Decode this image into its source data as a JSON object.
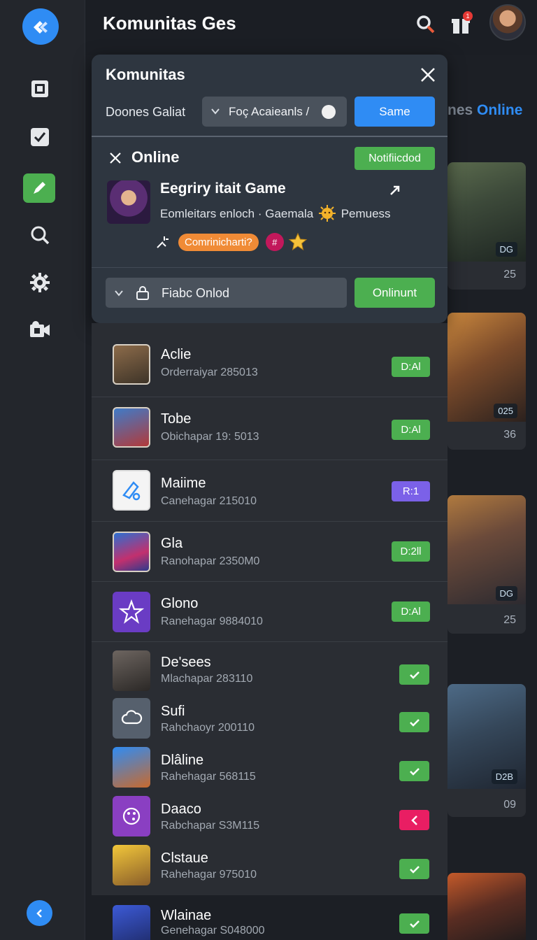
{
  "app": {
    "title": "Komunitas Ges"
  },
  "header": {
    "notification_count": "1"
  },
  "background": {
    "dim_text": "nes",
    "online_text": "Online",
    "cards": [
      {
        "tag": "DG",
        "number": "25"
      },
      {
        "tag": "025",
        "number": "36"
      },
      {
        "tag": "DG",
        "number": "25"
      },
      {
        "tag": "D2B",
        "number": "09"
      }
    ]
  },
  "modal": {
    "title": "Komunitas",
    "filter_label": "Doones Galiat",
    "filter_value": "Foç Acaieanls /",
    "save_label": "Same",
    "online_label": "Online",
    "notification_label": "Notifiicdod",
    "game": {
      "title": "Eegriry itait Game",
      "subtitle_a": "Eomleitars enloch · Gaemala",
      "subtitle_b": "Pemuess",
      "community_tag": "Comrinicharti?",
      "hash_chip": "#"
    },
    "online_select_value": "Fiabc Onlod",
    "online_button": "Onlinunt"
  },
  "list": [
    {
      "name": "Aclie",
      "meta": "Orderraiyar 285013",
      "badge": "D:Al",
      "badge_color": "green"
    },
    {
      "name": "Tobe",
      "meta": "Obichapar 19: 5013",
      "badge": "D:Al",
      "badge_color": "green"
    },
    {
      "name": "Maiime",
      "meta": "Canehagar 215010",
      "badge": "R:1",
      "badge_color": "purple"
    },
    {
      "name": "Gla",
      "meta": "Ranohapar 2350M0",
      "badge": "D:2ll",
      "badge_color": "green"
    },
    {
      "name": "Glono",
      "meta": "Ranehagar 9884010",
      "badge": "D:Al",
      "badge_color": "green"
    },
    {
      "name": "De'sees",
      "meta": "Mlachapar 283110",
      "status": "check",
      "status_color": "green"
    },
    {
      "name": "Sufi",
      "meta": "Rahchaoyr 200110",
      "status": "check",
      "status_color": "green"
    },
    {
      "name": "Dlâline",
      "meta": "Rahehagar 568115",
      "status": "check",
      "status_color": "green"
    },
    {
      "name": "Daaco",
      "meta": "Rabchapar S3M115",
      "status": "back",
      "status_color": "pink"
    },
    {
      "name": "Clstaue",
      "meta": "Rahehagar 975010",
      "status": "check",
      "status_color": "green"
    },
    {
      "name": "Wlainae",
      "meta": "Genehagar S048000",
      "status": "check",
      "status_color": "green"
    }
  ],
  "colors": {
    "accent": "#2f8cf4",
    "green": "#4caf50",
    "purple": "#7b61e8",
    "pink": "#e91e63",
    "orange": "#f08b36"
  },
  "icons": [
    "logo-icon",
    "square-icon",
    "checkbox-icon",
    "pencil-icon",
    "search-icon",
    "gear-icon",
    "camera-icon",
    "gift-icon",
    "close-icon",
    "chevron-down-icon",
    "lock-icon",
    "share-icon",
    "star-icon",
    "back-icon"
  ]
}
